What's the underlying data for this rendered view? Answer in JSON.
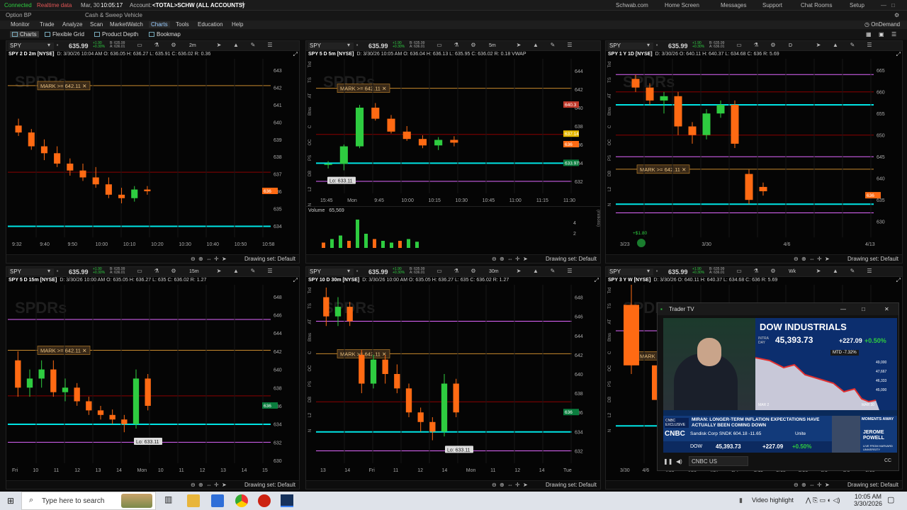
{
  "status": {
    "connected": "Connected",
    "realtime": "Realtime data",
    "date": "Mar, 30",
    "time": "10:05:17",
    "account_label": "Account:",
    "account": "<TOTAL>SCHW (ALL ACCOUNTS)",
    "option_bp": "Option BP",
    "cash_sweep": "Cash & Sweep Vehicle",
    "links": [
      "Schwab.com",
      "Home Screen",
      "Messages",
      "Support",
      "Chat Rooms",
      "Setup"
    ]
  },
  "menu": [
    "Monitor",
    "Trade",
    "Analyze",
    "Scan",
    "MarketWatch",
    "Charts",
    "Tools",
    "Education",
    "Help"
  ],
  "menu_active": "Charts",
  "ondemand": "OnDemand",
  "subtabs": [
    "Charts",
    "Flexible Grid",
    "Product Depth",
    "Bookmap"
  ],
  "colors": {
    "up": "#2ecc40",
    "down": "#ff6a13",
    "cyan": "#00e5e5",
    "magenta": "#e066ff",
    "red_line": "#8b0000",
    "mark": "#c88a2e"
  },
  "panels": [
    {
      "symbol": "SPY",
      "price": "635.99",
      "chg1": "+1.90",
      "chg2": "+0.30%",
      "bid": "B: 635.99",
      "ask": "A: 636.01",
      "agg": "2m",
      "info_title": "SPY 2 D 2m [NYSE]",
      "info": "D: 3/30/26 10:04 AM   O: 636.05   H: 636.27   L: 635.91   C: 636.02   R: 0.36",
      "mark": "MARK >= 642.11",
      "y_ticks": [
        "643",
        "642",
        "641",
        "640",
        "639",
        "638",
        "637",
        "636",
        "635",
        "634"
      ],
      "x_ticks": [
        "9:32",
        "9:40",
        "9:50",
        "10:00",
        "10:10",
        "10:20",
        "10:30",
        "10:40",
        "10:50",
        "10:58"
      ],
      "tag": "636",
      "draw_set": "Drawing set: Default"
    },
    {
      "symbol": "SPY",
      "price": "635.99",
      "chg1": "+1.90",
      "chg2": "+0.30%",
      "bid": "B: 635.99",
      "ask": "A: 636.01",
      "agg": "5m",
      "info_title": "SPY 5 D 5m [NYSE]",
      "info": "D: 3/30/26 10:05 AM   O: 636.04   H: 636.13   L: 635.95   C: 636.02   R: 0.18   VWAP",
      "mark": "MARK >= 642.11",
      "y_ticks": [
        "644",
        "642",
        "640",
        "638",
        "636",
        "634",
        "632"
      ],
      "x_ticks": [
        "15:45",
        "Mon",
        "9:45",
        "10:00",
        "10:15",
        "10:30",
        "10:45",
        "11:00",
        "11:15",
        "11:30"
      ],
      "lo": "Lo: 633.11",
      "vol_label": "Volume",
      "vol_value": "65,569",
      "vol_axis": "(millions)",
      "vol_ticks": [
        "4",
        "2"
      ],
      "tags": [
        "640.3",
        "637.14",
        "636",
        "633.97"
      ],
      "draw_set": "Drawing set: Default"
    },
    {
      "symbol": "SPY",
      "price": "635.99",
      "chg1": "+1.90",
      "chg2": "+0.30%",
      "bid": "B: 635.99",
      "ask": "A: 636.01",
      "agg": "D",
      "info_title": "SPY 1 Y 1D [NYSE]",
      "info": "D: 3/30/26   O: 640.11   H: 640.37   L: 634.68   C: 636   R: 5.69",
      "mark": "MARK >= 642.11",
      "y_ticks": [
        "665",
        "660",
        "655",
        "650",
        "645",
        "640",
        "635",
        "630"
      ],
      "x_ticks": [
        "3/23",
        "3/30",
        "4/6",
        "4/13"
      ],
      "tag": "636",
      "dividend": "+$1.80",
      "draw_set": "Drawing set: Default"
    },
    {
      "symbol": "SPY",
      "price": "635.99",
      "chg1": "+1.90",
      "chg2": "+0.30%",
      "bid": "B: 635.99",
      "ask": "A: 636.01",
      "agg": "15m",
      "info_title": "SPY 5 D 15m [NYSE]",
      "info": "D: 3/30/26 10:00 AM   O: 635.05   H: 636.27   L: 635   C: 636.02   R: 1.27",
      "mark": "MARK >= 642.11",
      "y_ticks": [
        "648",
        "646",
        "644",
        "642",
        "640",
        "638",
        "636",
        "634",
        "632",
        "630"
      ],
      "x_ticks": [
        "Fri",
        "10",
        "11",
        "12",
        "13",
        "14",
        "Mon",
        "10",
        "11",
        "12",
        "13",
        "14",
        "15"
      ],
      "lo": "Lo: 633.11",
      "tag": "636",
      "draw_set": "Drawing set: Default"
    },
    {
      "symbol": "SPY",
      "price": "635.99",
      "chg1": "+1.90",
      "chg2": "+0.30%",
      "bid": "B: 635.99",
      "ask": "A: 636.01",
      "agg": "30m",
      "info_title": "SPY 10 D 30m [NYSE]",
      "info": "D: 3/30/26 10:00 AM   O: 635.05   H: 636.27   L: 635   C: 636.02   R: 1.27",
      "mark": "MARK >= 642.11",
      "y_ticks": [
        "648",
        "646",
        "644",
        "642",
        "640",
        "638",
        "636",
        "634",
        "632"
      ],
      "x_ticks": [
        "13",
        "14",
        "Fri",
        "11",
        "12",
        "14",
        "Mon",
        "11",
        "12",
        "14",
        "Tue"
      ],
      "lo": "Lo: 633.11",
      "tag": "636",
      "draw_set": "Drawing set: Default"
    },
    {
      "symbol": "SPY",
      "price": "635.99",
      "chg1": "+1.90",
      "chg2": "+0.30%",
      "bid": "B: 635.99",
      "ask": "A: 636.01",
      "agg": "Wk",
      "info_title": "SPY 3 Y W [NYSE]",
      "info": "D: 3/30/26   O: 640.11   H: 640.37   L: 634.68   C: 636   R: 5.69",
      "mark": "MARK",
      "x_ticks": [
        "3/30",
        "4/6",
        "4/13",
        "4/20",
        "4/27",
        "5/4",
        "5/11",
        "5/18",
        "5/25",
        "6/1",
        "6/8",
        "6/15"
      ],
      "draw_set": "Drawing set: Default"
    }
  ],
  "side_tabs": [
    "Trd",
    "TS",
    "AT",
    "Btns",
    "C",
    "OC",
    "PS",
    "DB",
    "L2",
    "N"
  ],
  "tv": {
    "title": "Trader TV",
    "dow_title": "DOW INDUSTRIALS",
    "intraday": "INTRA DAY",
    "dow_value": "45,393.73",
    "dow_chg": "+227.09",
    "dow_pct": "+0.50%",
    "mtd": "MTD -7.32%",
    "chart_ticks": [
      "49,000",
      "47,667",
      "46,333",
      "45,000"
    ],
    "chart_x": [
      "MAR 2",
      "MAR 30"
    ],
    "lower_bug": "CNBC EXCLUSIVE",
    "headline": "MIRAN: LONGER-TERM INFLATION EXPECTATIONS HAVE ACTUALLY BEEN COMING DOWN",
    "moments": "MOMENTS AWAY",
    "guest": "JEROME POWELL",
    "guest_sub": "LIVE FROM HARVARD UNIVERSITY",
    "ticker1": "Sandisk Corp SNDK 604.18  -11.65",
    "ticker_extra": "Unite",
    "ticker_dow": "DOW",
    "ticker_dow_val": "45,393.73",
    "ticker_dow_chg": "+227.09",
    "ticker_dow_pct": "+0.50%",
    "logo": "CNBC",
    "channel": "CNBC US"
  },
  "taskbar": {
    "search_placeholder": "Type here to search",
    "video_highlight": "Video highlight",
    "clock_time": "10:05 AM",
    "clock_date": "3/30/2026"
  }
}
